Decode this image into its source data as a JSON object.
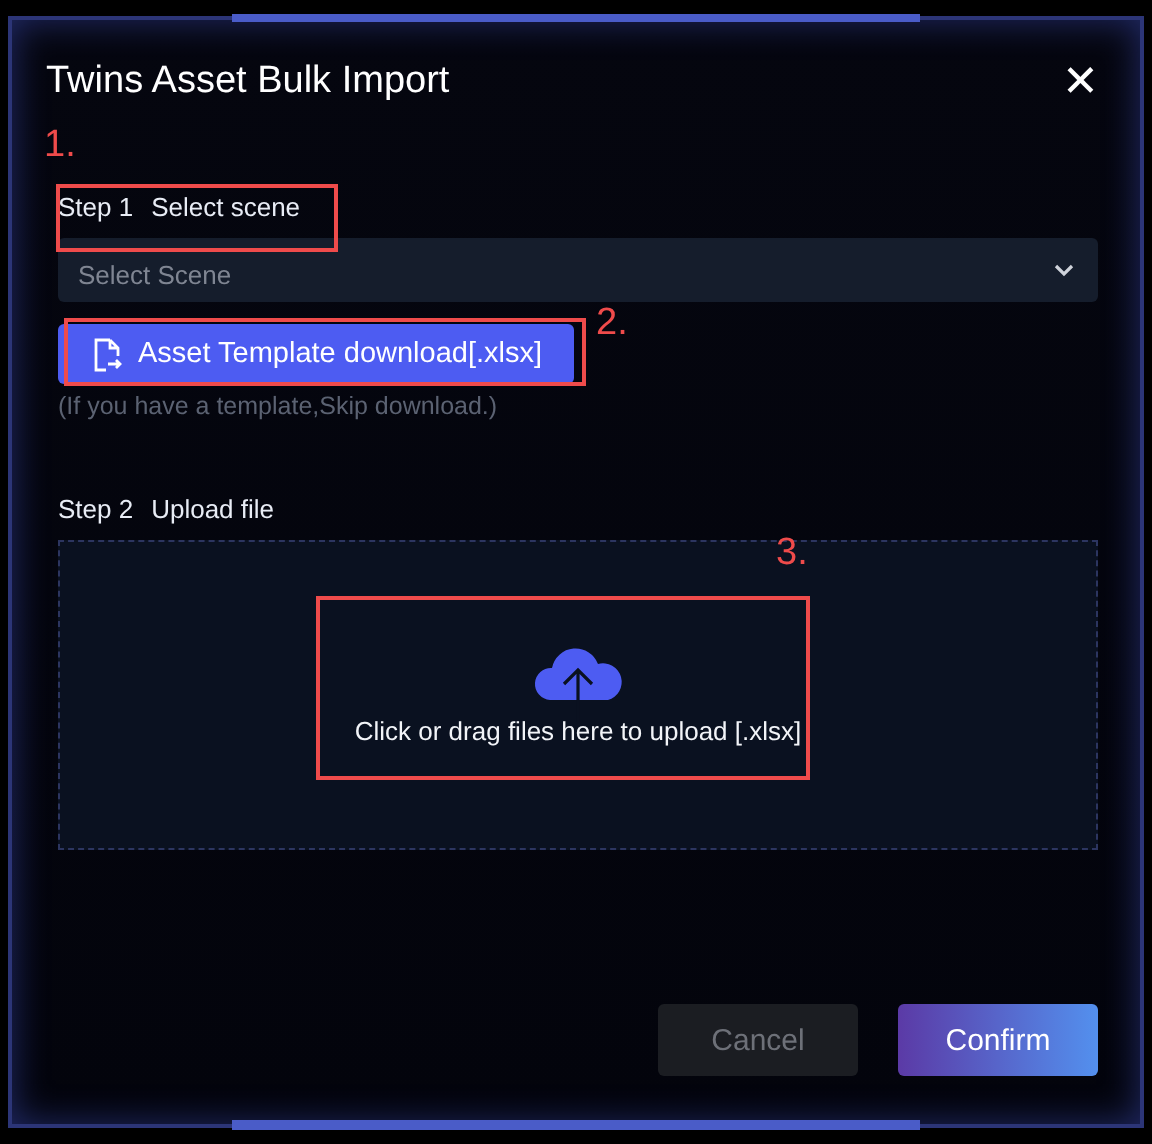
{
  "dialog": {
    "title": "Twins Asset Bulk Import",
    "close": "✕"
  },
  "step1": {
    "step": "Step 1",
    "label": "Select scene",
    "select": {
      "placeholder": "Select Scene"
    }
  },
  "template_button": {
    "label": "Asset Template download[.xlsx]"
  },
  "hint": "(If you have a template,Skip download.)",
  "step2": {
    "step": "Step 2",
    "label": "Upload file"
  },
  "upload": {
    "text": "Click or drag files here to upload [.xlsx]"
  },
  "buttons": [
    {
      "label": "Cancel",
      "kind": "secondary",
      "disabled": true
    },
    {
      "label": "Confirm",
      "kind": "primary",
      "disabled": false
    }
  ],
  "annotations": [
    {
      "number": "1."
    },
    {
      "number": "2."
    },
    {
      "number": "3."
    }
  ]
}
